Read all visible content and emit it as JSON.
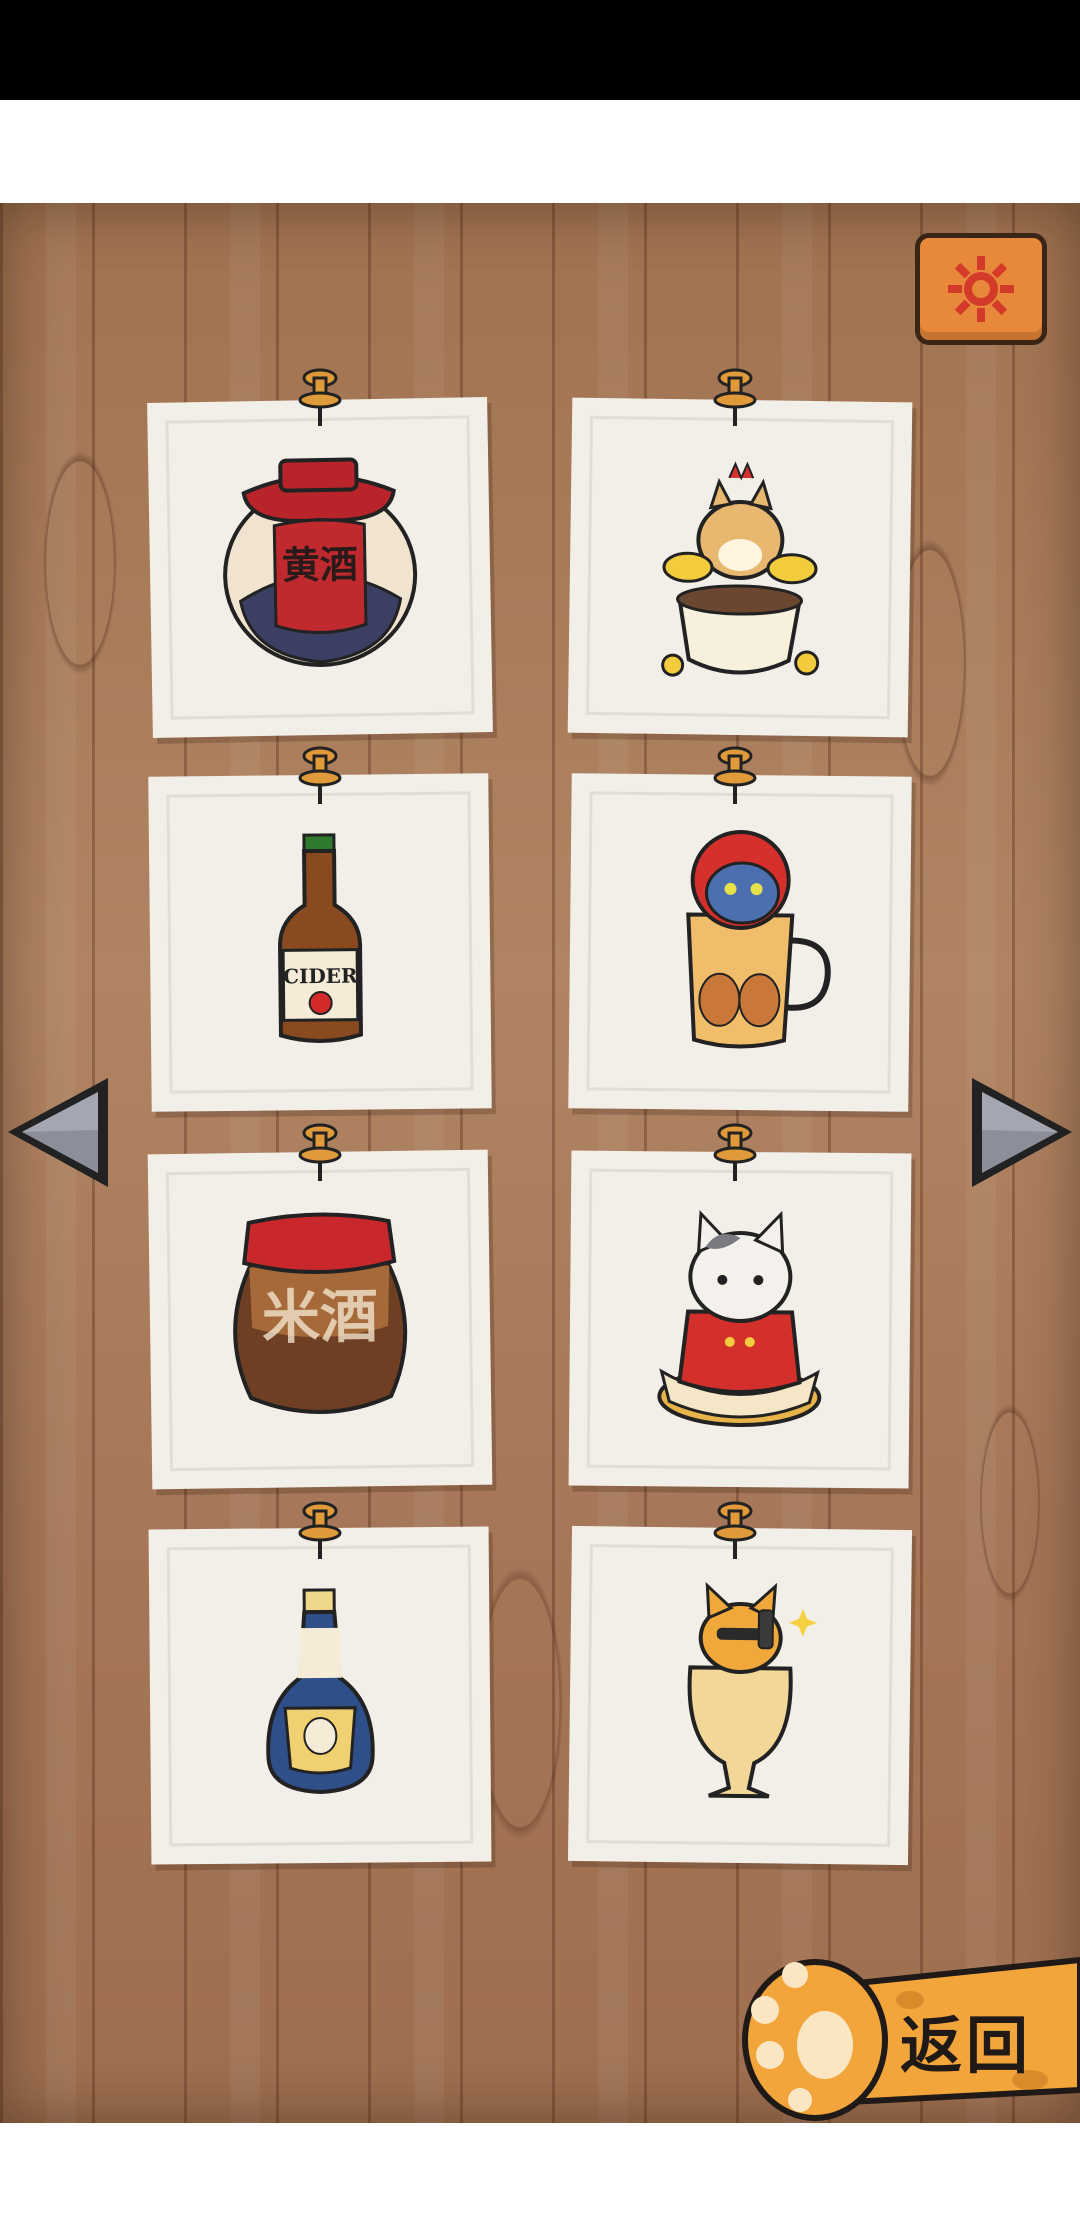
{
  "screen": {
    "title": "",
    "colors": {
      "wood": "#a97b5a",
      "card": "#f2efe9",
      "accent": "#e8883a",
      "paw": "#f2a53a"
    }
  },
  "settings": {
    "icon": "gear-icon"
  },
  "navigation": {
    "prev_icon": "triangle-left-icon",
    "next_icon": "triangle-right-icon"
  },
  "cards": [
    {
      "item": "huangjiu-jar",
      "label": "黄酒"
    },
    {
      "item": "shiba-cat-in-teacup-with-coins"
    },
    {
      "item": "cider-bottle",
      "label": "CIDER"
    },
    {
      "item": "blue-cat-in-apple-beer-mug"
    },
    {
      "item": "rice-wine-jar",
      "label": "米酒"
    },
    {
      "item": "cat-in-red-jacket-in-bowl"
    },
    {
      "item": "blue-liquor-bottle-with-cat-label"
    },
    {
      "item": "orange-cat-in-cocktail-glass"
    }
  ],
  "back_button": {
    "label": "返回",
    "icon": "paw-icon"
  }
}
